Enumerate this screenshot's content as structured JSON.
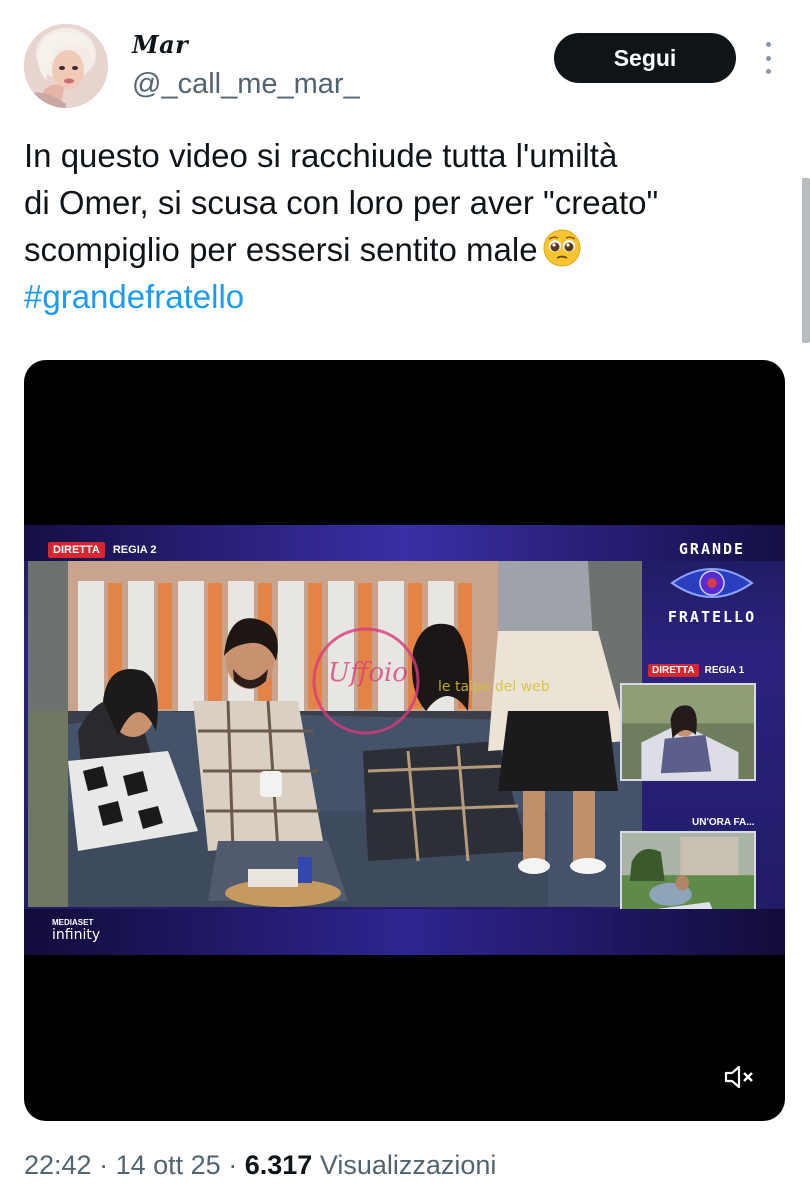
{
  "author": {
    "display_name": "Mar",
    "handle": "@_call_me_mar_",
    "follow_label": "Segui"
  },
  "tweet": {
    "lines": [
      "In questo video si racchiude tutta l'umiltà",
      "di Omer, si scusa  con loro per aver \"creato\"",
      "scompiglio per essersi sentito male"
    ],
    "emoji": "pleading-face-emoji",
    "hashtag": "#grandefratello"
  },
  "video": {
    "live_label": "DIRETTA",
    "channel_main": "REGIA 2",
    "channel_inset": "REGIA 1",
    "inset_caption": "UN'ORA FA...",
    "logo_line1": "GRANDE",
    "logo_line2": "FRATELLO",
    "broadcaster_small": "MEDIASET",
    "broadcaster_brand": "infinity",
    "mute_icon": "volume-muted-icon"
  },
  "meta": {
    "time": "22:42",
    "separator": "·",
    "date": "14 ott 25",
    "views_count": "6.317",
    "views_label": "Visualizzazioni"
  },
  "colors": {
    "text": "#0f1419",
    "secondary": "#536471",
    "link": "#1d9bf0",
    "follow_button": "#0f1419",
    "live_red": "#d7262f"
  }
}
